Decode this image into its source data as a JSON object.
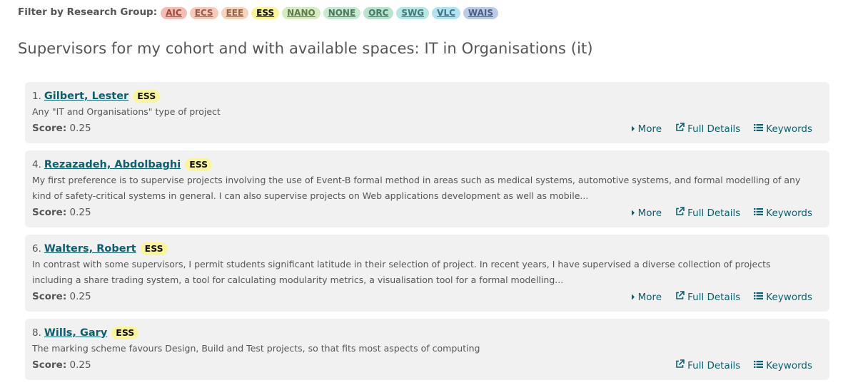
{
  "filter": {
    "label": "Filter by Research Group:",
    "groups": [
      {
        "label": "AIC",
        "bg": "#f5bcb3",
        "fg": "#9e4a3c"
      },
      {
        "label": "ECS",
        "bg": "#f6c9b8",
        "fg": "#9a5a45"
      },
      {
        "label": "EEE",
        "bg": "#f7d3bb",
        "fg": "#9a6448"
      },
      {
        "label": "ESS",
        "bg": "#fbf59a",
        "fg": "#111111"
      },
      {
        "label": "NANO",
        "bg": "#d6ecc3",
        "fg": "#5b7a4a"
      },
      {
        "label": "NONE",
        "bg": "#c7ead1",
        "fg": "#4e7a5c"
      },
      {
        "label": "ORC",
        "bg": "#b8e4cf",
        "fg": "#447a62"
      },
      {
        "label": "SWG",
        "bg": "#b7e6e4",
        "fg": "#3f7a78"
      },
      {
        "label": "VLC",
        "bg": "#b3e2f0",
        "fg": "#3c7488"
      },
      {
        "label": "WAIS",
        "bg": "#b9cbe6",
        "fg": "#4a5f82"
      }
    ]
  },
  "heading": "Supervisors for my cohort and with available spaces: IT in Organisations (it)",
  "actions": {
    "more": "More",
    "full": "Full Details",
    "keywords": "Keywords"
  },
  "supervisors": [
    {
      "num": "1.",
      "name": "Gilbert, Lester",
      "group": "ESS",
      "desc": "Any \"IT and Organisations\" type of project",
      "score_label": "Score:",
      "score": "0.25",
      "has_more": true
    },
    {
      "num": "4.",
      "name": "Rezazadeh, Abdolbaghi",
      "group": "ESS",
      "desc": "My first preference is to supervise projects involving the use of Event-B formal method in areas such as medical systems, automotive systems, and formal modelling of any kind of safety-critical systems in general. I can also supervise projects on Web applications development as well as mobile...",
      "score_label": "Score:",
      "score": "0.25",
      "has_more": true
    },
    {
      "num": "6.",
      "name": "Walters, Robert",
      "group": "ESS",
      "desc": "In contrast with some supervisors, I permit students significant latitude in their selection of project. In recent years, I have supervised a diverse collection of projects including a share trading system, a tool for calculating modularity metrics, a visualisation tool for a formal modelling...",
      "score_label": "Score:",
      "score": "0.25",
      "has_more": true
    },
    {
      "num": "8.",
      "name": "Wills, Gary",
      "group": "ESS",
      "desc": "The marking scheme favours Design, Build and Test projects, so that fits most aspects of computing",
      "score_label": "Score:",
      "score": "0.25",
      "has_more": false
    }
  ]
}
